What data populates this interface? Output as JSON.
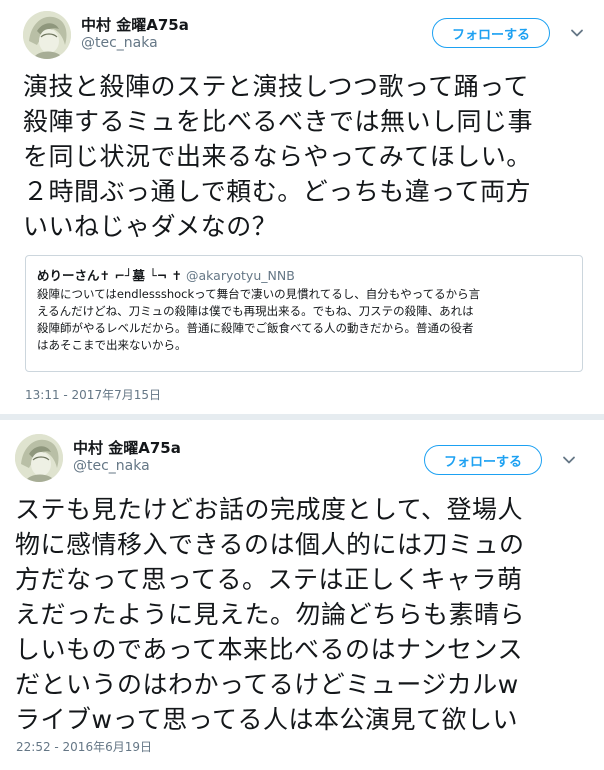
{
  "tweet1": {
    "display_name": "中村 金曜A75a",
    "handle": "@tec_naka",
    "follow_label": "フォローする",
    "body_lines": [
      "演技と殺陣のステと演技しつつ歌って踊って",
      "殺陣するミュを比べるべきでは無いし同じ事",
      "を同じ状況で出来るならやってみてほしい。",
      "２時間ぶっ通しで頼む。どっちも違って両方",
      "いいねじゃダメなの？"
    ],
    "quote": {
      "display_name": "めりーさん✝ ⌐┘墓 └¬ ✝",
      "handle": "@akaryotyu_NNB",
      "lines": [
        "殺陣についてはendlessshockって舞台で凄いの見慣れてるし、自分もやってるから言",
        "えるんだけどね、刀ミュの殺陣は僕でも再現出来る。でもね、刀ステの殺陣、あれは",
        "殺陣師がやるレベルだから。普通に殺陣でご飯食べてる人の動きだから。普通の役者",
        "はあそこまで出来ないから。"
      ]
    },
    "timestamp": "13:11 - 2017年7月15日"
  },
  "tweet2": {
    "display_name": "中村 金曜A75a",
    "handle": "@tec_naka",
    "follow_label": "フォローする",
    "body_lines": [
      "ステも見たけどお話の完成度として、登場人",
      "物に感情移入できるのは個人的には刀ミュの",
      "方だなって思ってる。ステは正しくキャラ萌",
      "えだったように見えた。勿論どちらも素晴ら",
      "しいものであって本来比べるのはナンセンス",
      "だというのはわかってるけどミュージカルw",
      "ライブwって思ってる人は本公演見て欲しい"
    ],
    "timestamp": "22:52 - 2016年6月19日"
  },
  "icons": {
    "avatar": "avatar-illustration",
    "chevron": "chevron-down-icon"
  },
  "colors": {
    "accent": "#1da1f2",
    "secondary_text": "#657786",
    "border": "#ccd6dd",
    "divider": "#e6ecf0"
  }
}
